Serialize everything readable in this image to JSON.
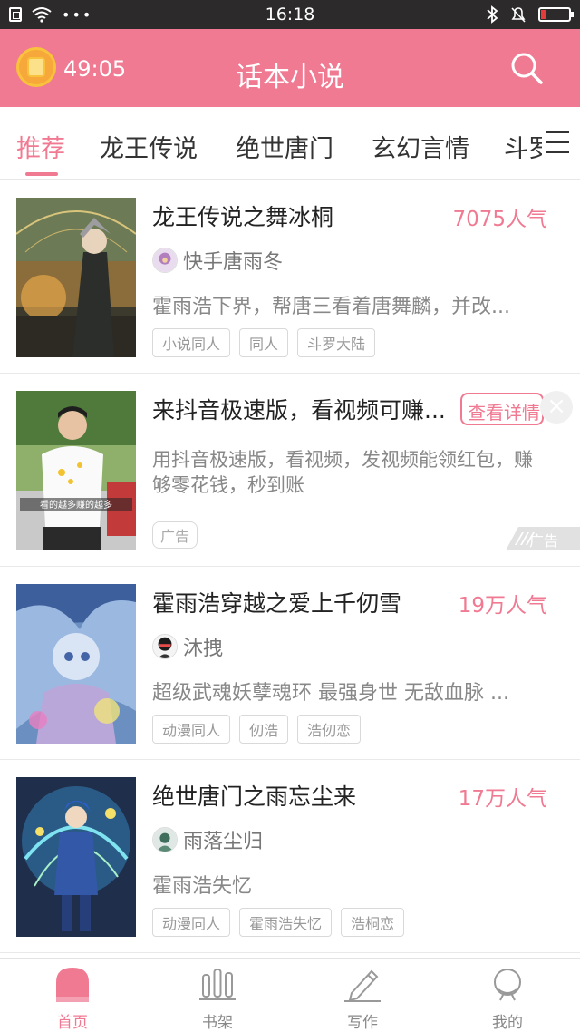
{
  "status_bar": {
    "time": "16:18",
    "dots": "•••",
    "bluetooth": "✱",
    "bell": "🔕",
    "battery_fraction": 0.15
  },
  "header": {
    "timer": "49:05",
    "title": "话本小说",
    "accent_color": "#f07a92"
  },
  "tabs": [
    {
      "label": "推荐",
      "active": true
    },
    {
      "label": "龙王传说",
      "active": false
    },
    {
      "label": "绝世唐门",
      "active": false
    },
    {
      "label": "玄幻言情",
      "active": false
    },
    {
      "label": "斗罗",
      "active": false
    }
  ],
  "cards": [
    {
      "title": "龙王传说之舞冰桐",
      "popularity": "7075人气",
      "author": "快手唐雨冬",
      "description": "霍雨浩下界，帮唐三看着唐舞麟，并改...",
      "tags": [
        "小说同人",
        "同人",
        "斗罗大陆"
      ]
    },
    {
      "title": "霍雨浩穿越之爱上千仞雪",
      "popularity": "19万人气",
      "author": "沐拽",
      "description": "超级武魂妖孽魂环  最强身世  无敌血脉 ...",
      "tags": [
        "动漫同人",
        "仞浩",
        "浩仞恋"
      ]
    },
    {
      "title": "绝世唐门之雨忘尘来",
      "popularity": "17万人气",
      "author": "雨落尘归",
      "description": "霍雨浩失忆",
      "tags": [
        "动漫同人",
        "霍雨浩失忆",
        "浩桐恋"
      ]
    }
  ],
  "ad": {
    "title": "来抖音极速版，看视频可赚...",
    "cta": "查看详情",
    "close": "×",
    "description": "用抖音极速版，看视频，发视频能领红包，赚够零花钱，秒到账",
    "badge": "广告",
    "corner_label": "广告",
    "cover_caption": "看的越多赚的越多"
  },
  "bottom_nav": [
    {
      "label": "首页",
      "icon": "home-icon",
      "active": true
    },
    {
      "label": "书架",
      "icon": "bookshelf-icon",
      "active": false
    },
    {
      "label": "写作",
      "icon": "pen-icon",
      "active": false
    },
    {
      "label": "我的",
      "icon": "profile-icon",
      "active": false
    }
  ]
}
